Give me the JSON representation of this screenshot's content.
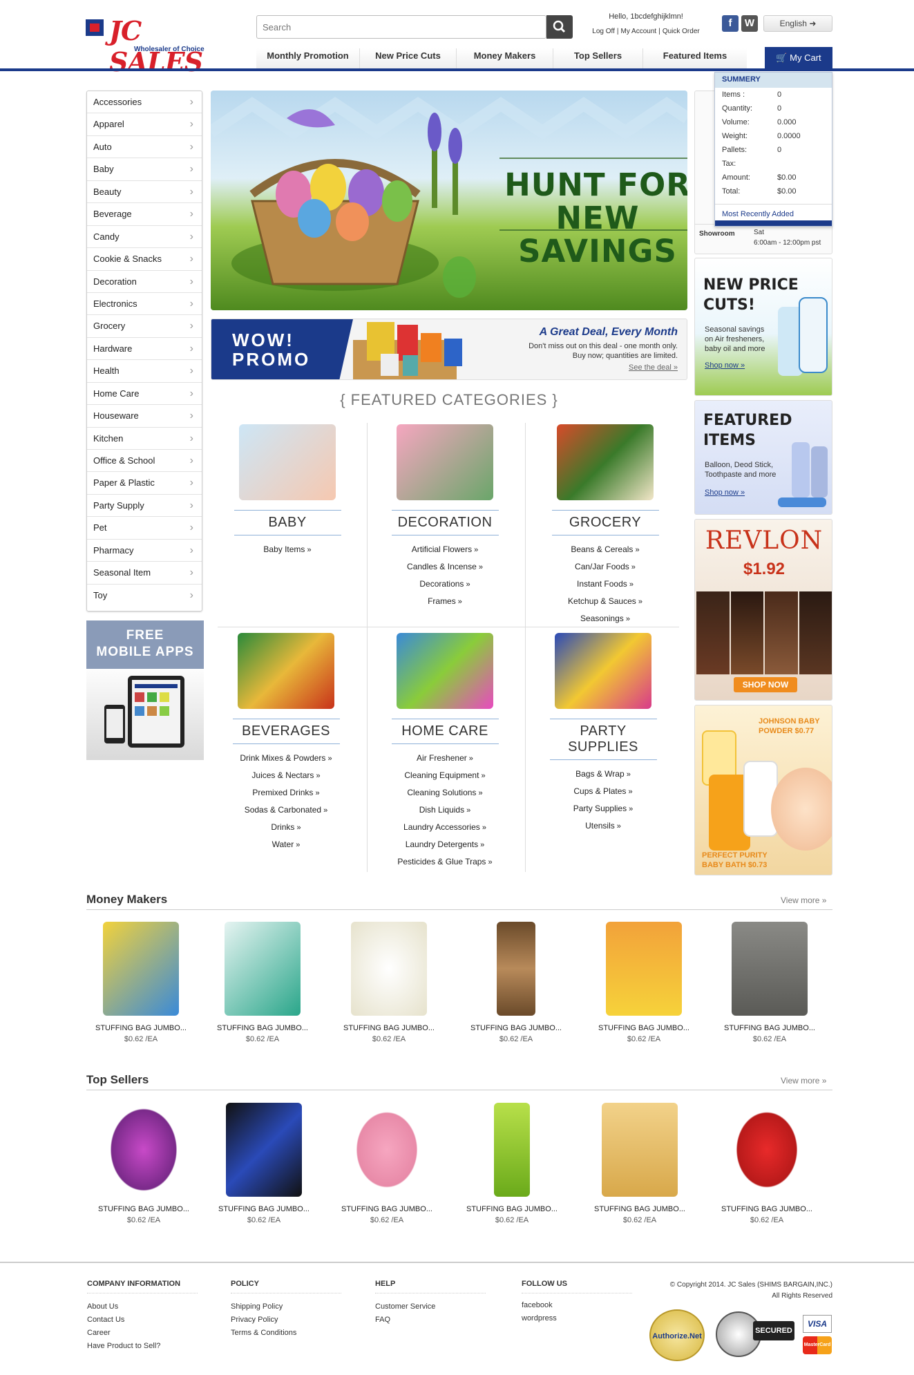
{
  "brand": {
    "name": "JC SALES",
    "tagline": "Wholesaler of Choice"
  },
  "search": {
    "placeholder": "Search"
  },
  "account": {
    "greeting": "Hello, 1bcdefghijklmn!",
    "links": [
      "Log Off",
      "My Account",
      "Quick Order"
    ]
  },
  "language": "English",
  "nav": [
    "Monthly Promotion",
    "New Price Cuts",
    "Money Makers",
    "Top Sellers",
    "Featured Items"
  ],
  "cart": {
    "button": "My Cart",
    "title": "SUMMERY",
    "rows": [
      {
        "label": "Items :",
        "value": "0"
      },
      {
        "label": "Quantity:",
        "value": "0"
      },
      {
        "label": "Volume:",
        "value": "0.000"
      },
      {
        "label": "Weight:",
        "value": "0.0000"
      },
      {
        "label": "Pallets:",
        "value": "0"
      },
      {
        "label": "Tax:",
        "value": ""
      },
      {
        "label": "Amount:",
        "value": "$0.00"
      },
      {
        "label": "Total:",
        "value": "$0.00"
      }
    ],
    "footer": "Most Recently Added"
  },
  "categories": [
    "Accessories",
    "Apparel",
    "Auto",
    "Baby",
    "Beauty",
    "Beverage",
    "Candy",
    "Cookie & Snacks",
    "Decoration",
    "Electronics",
    "Grocery",
    "Hardware",
    "Health",
    "Home Care",
    "Houseware",
    "Kitchen",
    "Office & School",
    "Paper & Plastic",
    "Party Supply",
    "Pet",
    "Pharmacy",
    "Seasonal Item",
    "Toy"
  ],
  "mobile_apps": {
    "line1": "FREE",
    "line2": "MOBILE APPS"
  },
  "hero": {
    "line1": "HUNT FOR",
    "line2": "NEW SAVINGS"
  },
  "promo": {
    "badge1": "WOW!",
    "badge2": "PROMO",
    "headline": "A Great Deal, Every Month",
    "desc1": "Don't miss out on this deal - one month only.",
    "desc2": "Buy now; quantities are limited.",
    "link": "See the deal »"
  },
  "featured": {
    "title": "{ FEATURED CATEGORIES }",
    "items": [
      {
        "name": "BABY",
        "links": [
          "Baby Items"
        ]
      },
      {
        "name": "DECORATION",
        "links": [
          "Artificial Flowers",
          "Candles & Incense",
          "Decorations",
          "Frames"
        ]
      },
      {
        "name": "GROCERY",
        "links": [
          "Beans & Cereals",
          "Can/Jar Foods",
          "Instant Foods",
          "Ketchup & Sauces",
          "Seasonings"
        ]
      },
      {
        "name": "BEVERAGES",
        "links": [
          "Drink Mixes & Powders",
          "Juices & Nectars",
          "Premixed Drinks",
          "Sodas & Carbonated",
          "Drinks",
          "Water"
        ]
      },
      {
        "name": "HOME CARE",
        "links": [
          "Air Freshener",
          "Cleaning Equipment",
          "Cleaning Solutions",
          "Dish Liquids",
          "Laundry Accessories",
          "Laundry Detergents",
          "Pesticides & Glue Traps"
        ]
      },
      {
        "name": "PARTY SUPPLIES",
        "links": [
          "Bags & Wrap",
          "Cups & Plates",
          "Party Supplies",
          "Utensils"
        ]
      }
    ]
  },
  "showroom": {
    "label": "Showroom",
    "day": "Sat",
    "hours": "6:00am - 12:00pm pst"
  },
  "ads": {
    "price_cuts": {
      "title1": "NEW PRICE",
      "title2": "CUTS!",
      "desc": "Seasonal savings on Air fresheners, baby oil and more",
      "link": "Shop now »"
    },
    "featured_items": {
      "title1": "FEATURED",
      "title2": "ITEMS",
      "desc": "Balloon, Deod Stick, Toothpaste and more",
      "link": "Shop now »"
    },
    "revlon": {
      "brand": "REVLON",
      "price": "$1.92",
      "button": "SHOP NOW"
    },
    "johnson": {
      "top": "JOHNSON BABY POWDER $0.77",
      "bottom": "PERFECT PURITY BABY BATH $0.73"
    }
  },
  "money_makers": {
    "title": "Money Makers",
    "more": "View more »",
    "items": [
      {
        "name": "STUFFING BAG JUMBO...",
        "price": "$0.62 /EA"
      },
      {
        "name": "STUFFING BAG JUMBO...",
        "price": "$0.62 /EA"
      },
      {
        "name": "STUFFING BAG JUMBO...",
        "price": "$0.62 /EA"
      },
      {
        "name": "STUFFING BAG JUMBO...",
        "price": "$0.62 /EA"
      },
      {
        "name": "STUFFING BAG JUMBO...",
        "price": "$0.62 /EA"
      },
      {
        "name": "STUFFING BAG JUMBO...",
        "price": "$0.62 /EA"
      }
    ]
  },
  "top_sellers": {
    "title": "Top Sellers",
    "more": "View more »",
    "items": [
      {
        "name": "STUFFING BAG JUMBO...",
        "price": "$0.62 /EA"
      },
      {
        "name": "STUFFING BAG JUMBO...",
        "price": "$0.62 /EA"
      },
      {
        "name": "STUFFING BAG JUMBO...",
        "price": "$0.62 /EA"
      },
      {
        "name": "STUFFING BAG JUMBO...",
        "price": "$0.62 /EA"
      },
      {
        "name": "STUFFING BAG JUMBO...",
        "price": "$0.62 /EA"
      },
      {
        "name": "STUFFING BAG JUMBO...",
        "price": "$0.62 /EA"
      }
    ]
  },
  "footer": {
    "company": {
      "title": "COMPANY INFORMATION",
      "links": [
        "About Us",
        "Contact Us",
        "Career",
        "Have Product to Sell?"
      ]
    },
    "policy": {
      "title": "POLICY",
      "links": [
        "Shipping Policy",
        "Privacy Policy",
        "Terms & Conditions"
      ]
    },
    "help": {
      "title": "HELP",
      "links": [
        "Customer Service",
        "FAQ"
      ]
    },
    "follow": {
      "title": "FOLLOW US",
      "links": [
        "facebook",
        "wordpress"
      ]
    },
    "copyright1": "© Copyright 2014. JC Sales (SHIMS BARGAIN,INC.)",
    "copyright2": "All Rights Reserved",
    "seals": {
      "authorize": "Authorize.Net",
      "godaddy": "SECURED",
      "visa": "VISA",
      "mastercard": "MasterCard"
    }
  },
  "colors": {
    "brand_blue": "#1b3a8a",
    "brand_red": "#d8202a",
    "accent_orange": "#f08c1e"
  }
}
